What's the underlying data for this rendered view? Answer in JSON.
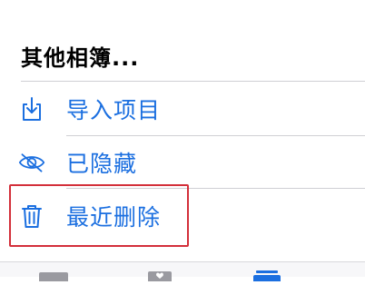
{
  "section": {
    "title": "其他相簿..."
  },
  "items": [
    {
      "label": "导入项目",
      "icon": "import-icon"
    },
    {
      "label": "已隐藏",
      "icon": "eye-slash-icon"
    },
    {
      "label": "最近删除",
      "icon": "trash-icon"
    }
  ],
  "tabbar": {
    "icons": [
      "photos-tab-icon",
      "for-you-tab-icon",
      "albums-tab-icon"
    ]
  },
  "colors": {
    "accent": "#1b6fe0",
    "highlight": "#d32f3a",
    "divider": "#cfcfd4",
    "tab_inactive": "#9a9aa0"
  }
}
